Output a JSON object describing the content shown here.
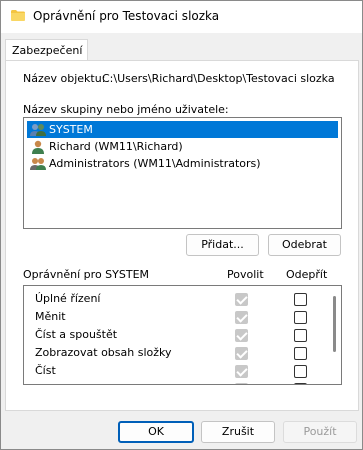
{
  "window": {
    "title": "Oprávnění pro Testovaci slozka"
  },
  "tabs": [
    {
      "label": "Zabezpečení"
    }
  ],
  "object": {
    "label": "Název objektu:",
    "value": "C:\\Users\\Richard\\Desktop\\Testovaci slozka"
  },
  "groups": {
    "label": "Název skupiny nebo jméno uživatele:",
    "items": [
      {
        "name": "SYSTEM",
        "icon": "group-users-icon",
        "selected": true
      },
      {
        "name": "Richard (WM11\\Richard)",
        "icon": "user-icon",
        "selected": false
      },
      {
        "name": "Administrators (WM11\\Administrators)",
        "icon": "group-users-icon",
        "selected": false
      }
    ],
    "add_button": "Přidat...",
    "remove_button": "Odebrat"
  },
  "permissions": {
    "label": "Oprávnění pro SYSTEM",
    "allow_header": "Povolit",
    "deny_header": "Odepřít",
    "rows": [
      {
        "name": "Úplné řízení",
        "allow": true,
        "deny": false
      },
      {
        "name": "Měnit",
        "allow": true,
        "deny": false
      },
      {
        "name": "Číst a spouštět",
        "allow": true,
        "deny": false
      },
      {
        "name": "Zobrazovat obsah složky",
        "allow": true,
        "deny": false
      },
      {
        "name": "Číst",
        "allow": true,
        "deny": false
      }
    ]
  },
  "footer": {
    "ok": "OK",
    "cancel": "Zrušit",
    "apply": "Použít"
  },
  "colors": {
    "selection": "#0078d7",
    "primary_border": "#005fb8",
    "folder": "#f4c542"
  }
}
